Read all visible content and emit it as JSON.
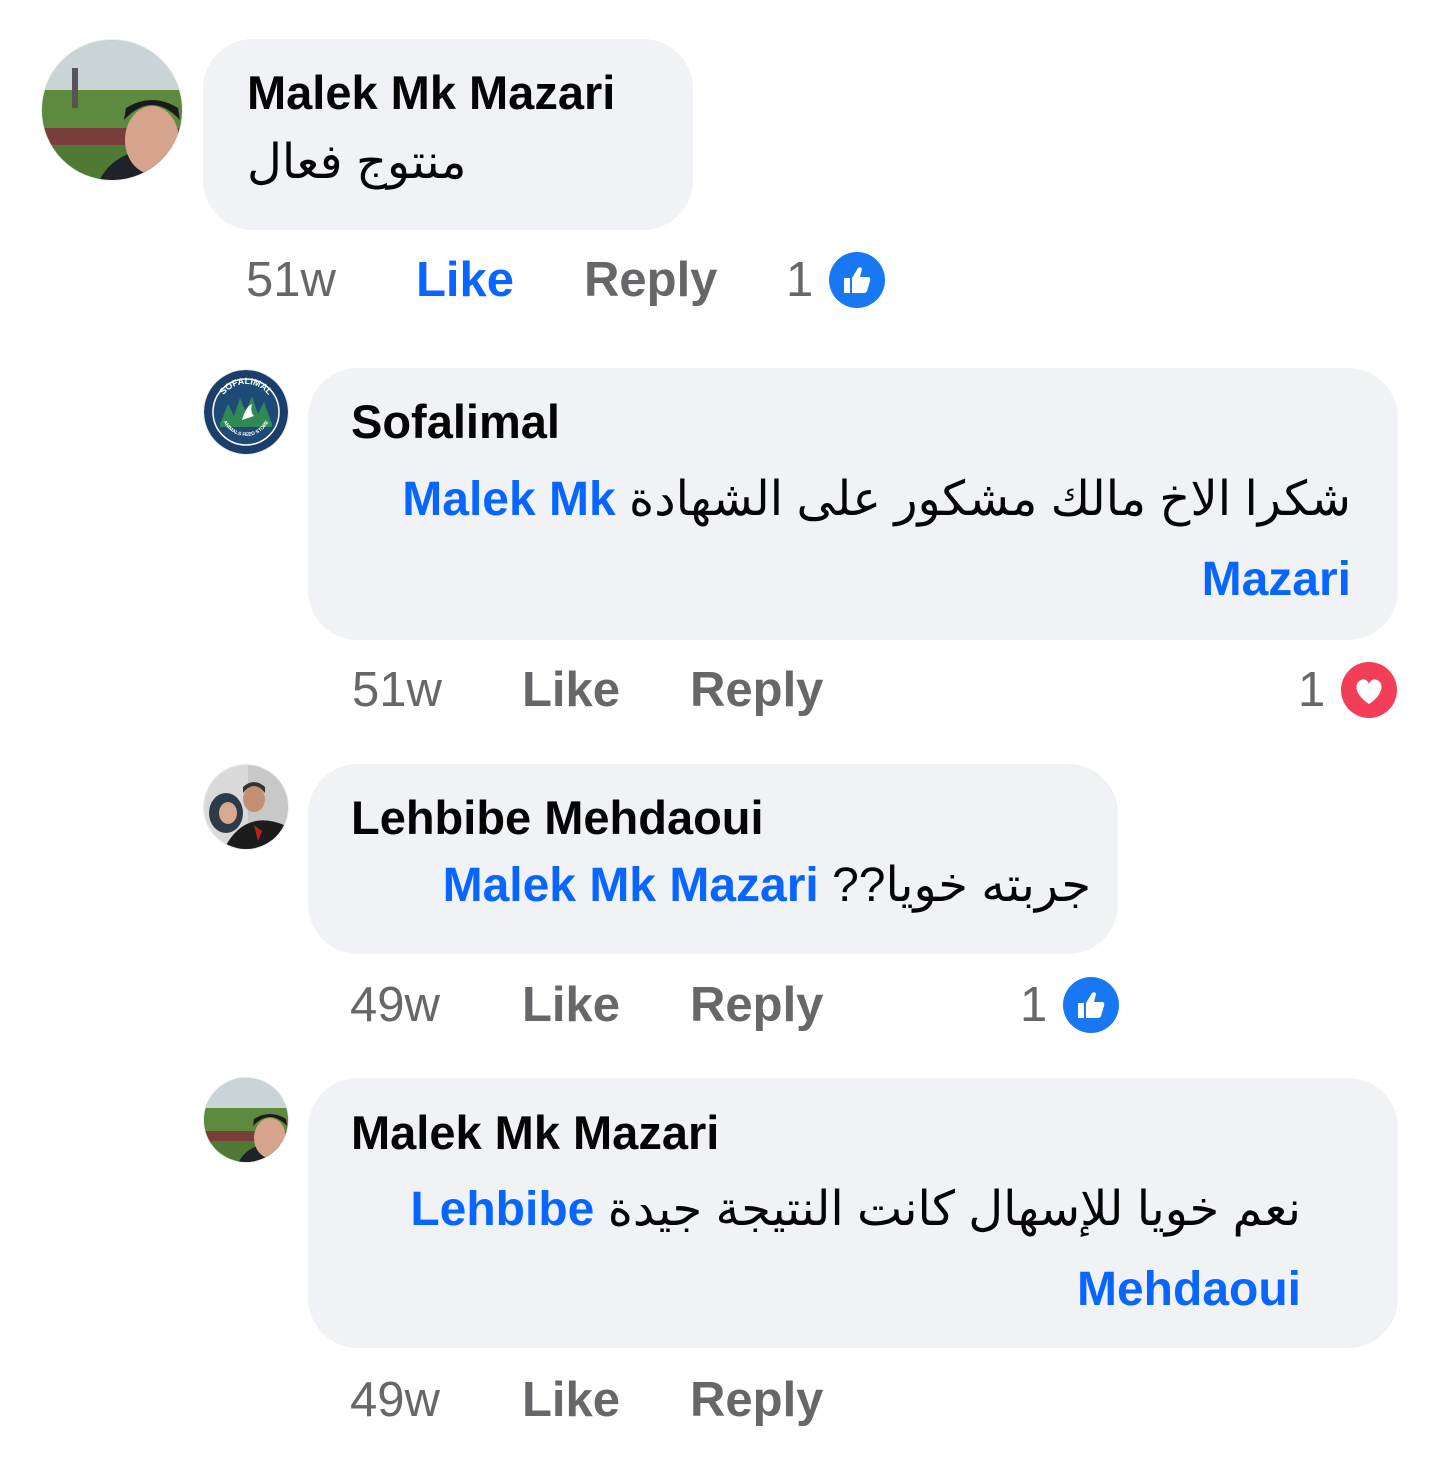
{
  "comments": [
    {
      "author": "Malek Mk Mazari",
      "text": "منتوج فعال",
      "time": "51w",
      "like_label": "Like",
      "reply_label": "Reply",
      "reaction_count": "1",
      "reaction_icon": "like-thumb-icon",
      "like_active": true
    },
    {
      "author": "Sofalimal",
      "mention": "Malek Mk Mazari",
      "text": "شكرا الاخ مالك مشكور على الشهادة",
      "time": "51w",
      "like_label": "Like",
      "reply_label": "Reply",
      "reaction_count": "1",
      "reaction_icon": "love-heart-icon"
    },
    {
      "author": "Lehbibe Mehdaoui",
      "mention": "Malek Mk Mazari",
      "text": "جربته خويا??",
      "time": "49w",
      "like_label": "Like",
      "reply_label": "Reply",
      "reaction_count": "1",
      "reaction_icon": "like-thumb-icon"
    },
    {
      "author": "Malek Mk Mazari",
      "mention": "Lehbibe Mehdaoui",
      "text": "نعم خويا  للإسهال كانت النتيجة جيدة",
      "time": "49w",
      "like_label": "Like",
      "reply_label": "Reply"
    }
  ],
  "logo_text": {
    "top": "SOFALIMAL",
    "bottom": "ANIMALS FEED STORE"
  },
  "colors": {
    "bubble": "#f0f2f5",
    "link_blue": "#0866ff",
    "meta_gray": "#65676b",
    "like_blue": "#1877f2",
    "love_red": "#f33e58"
  }
}
